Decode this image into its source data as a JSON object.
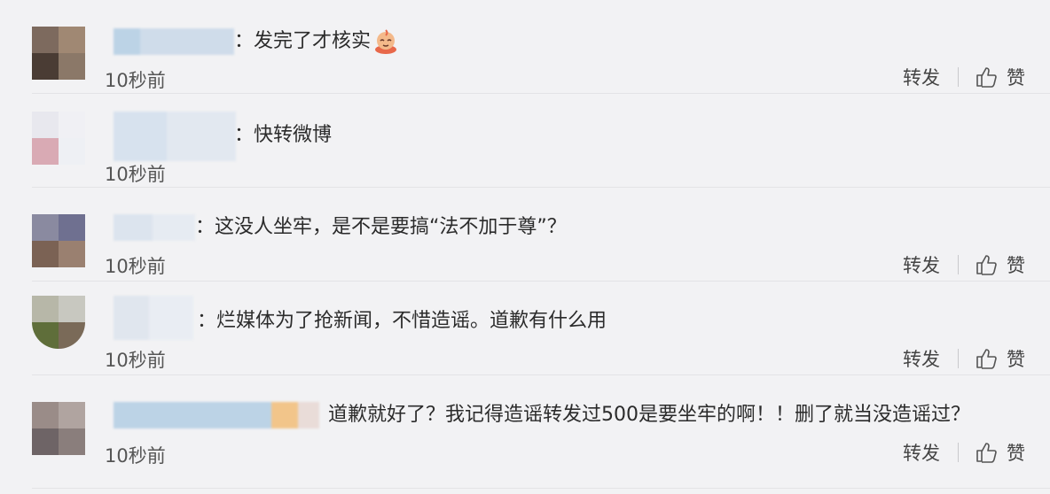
{
  "actions": {
    "repost_label": "转发",
    "like_label": "赞"
  },
  "comments": [
    {
      "text": "：发完了才核实",
      "time": "10秒前",
      "emoji": "doge-emoji",
      "avatar_colors": [
        "#7d6a5e",
        "#a08873",
        "#4a3c34",
        "#8b7868"
      ],
      "name_colors": [
        "#bcd3e6",
        "#cfdcea"
      ]
    },
    {
      "text": "：快转微博",
      "time": "10秒前",
      "avatar_colors": [
        "#e8e8ee",
        "#f0f0f4",
        "#d9aab4",
        "#eef0f4"
      ],
      "name_colors": [
        "#d7e2ee",
        "#e2e8f0"
      ]
    },
    {
      "text": "：这没人坐牢，是不是要搞“法不加于尊”？",
      "time": "10秒前",
      "avatar_colors": [
        "#8a8aa0",
        "#6f7090",
        "#7b6254",
        "#9a8070"
      ],
      "name_colors": [
        "#dce4ee",
        "#e6ebf2"
      ]
    },
    {
      "text": "：烂媒体为了抢新闻，不惜造谣。道歉有什么用",
      "time": "10秒前",
      "avatar_colors": [
        "#b7b7a8",
        "#c8c8c0",
        "#5f6e3a",
        "#7a6a58"
      ],
      "name_colors": [
        "#e0e6ee",
        "#e9edf3"
      ]
    },
    {
      "text": "道歉就好了？我记得造谣转发过500是要坐牢的啊！！删了就当没造谣过？",
      "time": "10秒前",
      "avatar_colors": [
        "#9a8c88",
        "#b0a4a0",
        "#6e6466",
        "#8a7e7c"
      ],
      "name_colors": [
        "#bcd3e6",
        "#f2c58a",
        "#e9dcd8"
      ]
    }
  ]
}
